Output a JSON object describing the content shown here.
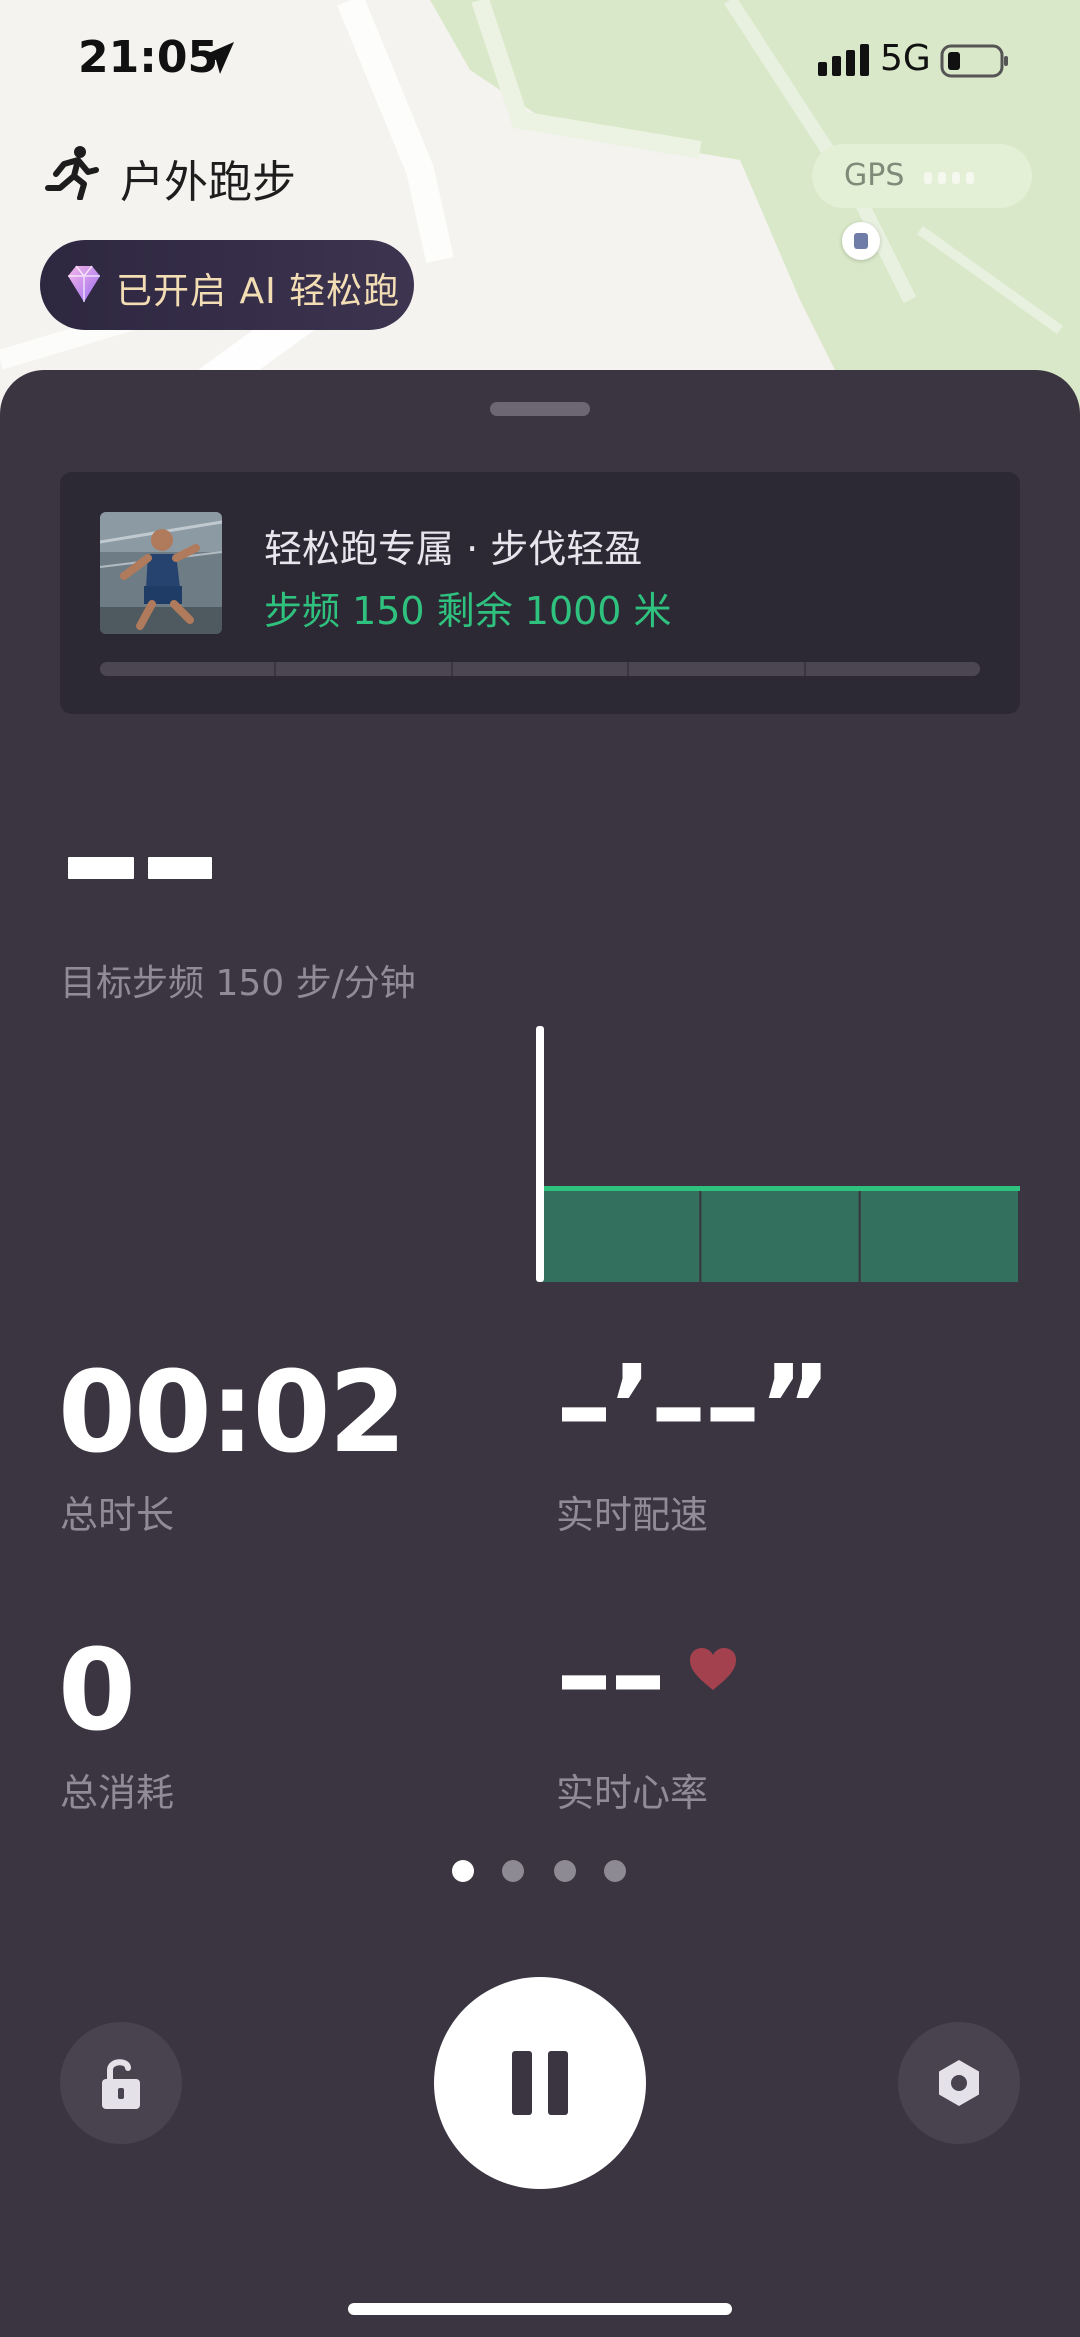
{
  "status_bar": {
    "time": "21:05",
    "network": "5G"
  },
  "header": {
    "mode_title": "户外跑步",
    "gps_label": "GPS",
    "ai_badge": "已开启 AI 轻松跑"
  },
  "workout_card": {
    "title": "轻松跑专属 · 步伐轻盈",
    "subtitle": "步频 150 剩余 1000 米",
    "progress_segments": 5,
    "progress_fraction": 0
  },
  "cadence": {
    "current_placeholder": "--",
    "target_label": "目标步频 150 步/分钟"
  },
  "chart_data": {
    "type": "area",
    "target": 150,
    "segments": 3
  },
  "metrics": {
    "duration": {
      "value": "00:02",
      "label": "总时长"
    },
    "pace": {
      "value": "–’––”",
      "label": "实时配速"
    },
    "calories": {
      "value": "0",
      "label": "总消耗"
    },
    "heart_rate": {
      "value": "––",
      "label": "实时心率"
    }
  },
  "pager": {
    "count": 4,
    "active_index": 0
  },
  "controls": {
    "lock_icon": "unlock-icon",
    "pause_icon": "pause-icon",
    "settings_icon": "hexagon-settings-icon"
  },
  "colors": {
    "sheet_bg": "#3a3541",
    "accent_green": "#2fc27f",
    "chart_fill": "#33705e",
    "ai_badge_text": "#f3ddb4",
    "heart": "#a4414e"
  }
}
